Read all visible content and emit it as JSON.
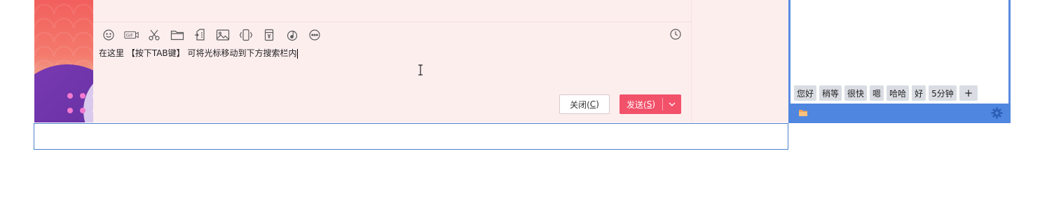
{
  "chat": {
    "input_text": "在这里 【按下TAB键】 可将光标移动到下方搜索栏内",
    "close_label": "关闭(",
    "close_key": "C",
    "close_end": ")",
    "send_label": "发送(",
    "send_key": "S",
    "send_end": ")",
    "toolbar_icons": [
      "emoji-icon",
      "gif-icon",
      "scissors-icon",
      "folder-icon",
      "file-transfer-icon",
      "image-icon",
      "shake-icon",
      "red-packet-icon",
      "music-icon",
      "more-icon"
    ],
    "accent": "#f2516a"
  },
  "panel": {
    "phrases": [
      "您好",
      "稍等",
      "很快",
      "嗯",
      "哈哈",
      "好",
      "5分钟",
      "+"
    ],
    "accent": "#4f86df"
  },
  "search": {
    "value": ""
  }
}
